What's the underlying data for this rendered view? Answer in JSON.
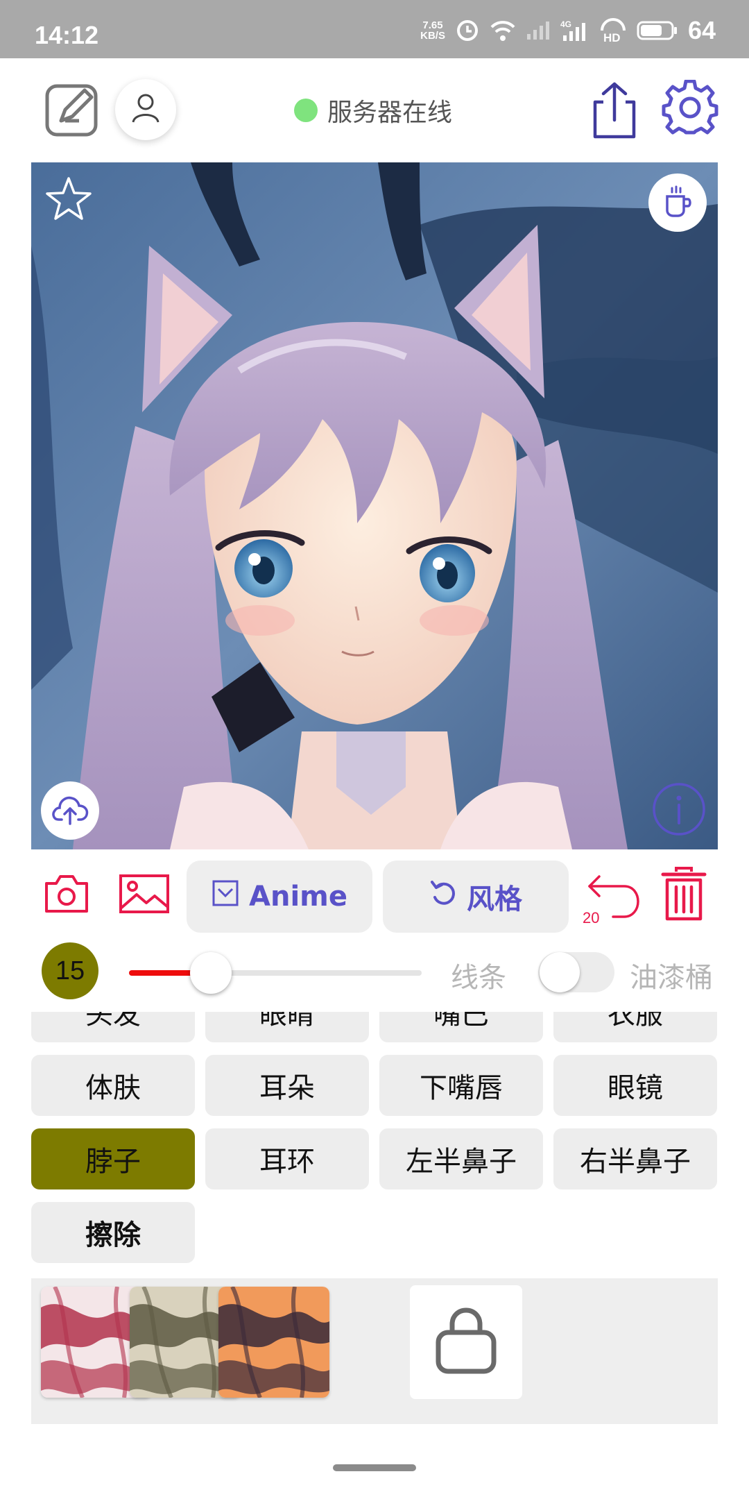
{
  "status_bar": {
    "time": "14:12",
    "net_speed_value": "7.65",
    "net_speed_unit": "KB/S",
    "network": "4G",
    "hd": "HD",
    "battery": "64"
  },
  "toolbar": {
    "server_status": "服务器在线",
    "status_color": "#7fe37e"
  },
  "actions": {
    "mode_label": "Anime",
    "style_label": "风格",
    "undo_count": "20"
  },
  "brush": {
    "size": "15",
    "slider_fraction": 0.28,
    "line_label": "线条",
    "bucket_label": "油漆桶",
    "bucket_enabled": false
  },
  "parts": [
    {
      "label": "头发"
    },
    {
      "label": "眼睛"
    },
    {
      "label": "嘴巴"
    },
    {
      "label": "衣服"
    },
    {
      "label": "体肤"
    },
    {
      "label": "耳朵"
    },
    {
      "label": "下嘴唇"
    },
    {
      "label": "眼镜"
    },
    {
      "label": "脖子",
      "selected": true
    },
    {
      "label": "耳环"
    },
    {
      "label": "左半鼻子"
    },
    {
      "label": "右半鼻子"
    },
    {
      "label": "擦除"
    }
  ],
  "textures": [
    {
      "name": "red-marble-texture",
      "colors": [
        "#f4e6e8",
        "#b2324c"
      ]
    },
    {
      "name": "olive-marble-texture",
      "colors": [
        "#d9d2bd",
        "#5d5a43"
      ]
    },
    {
      "name": "orange-marble-texture",
      "colors": [
        "#f19a5b",
        "#3a2a3a"
      ]
    }
  ],
  "colors": {
    "accent_red": "#e8194a",
    "accent_purple": "#5952c8",
    "selected_part": "#7d7b00"
  }
}
